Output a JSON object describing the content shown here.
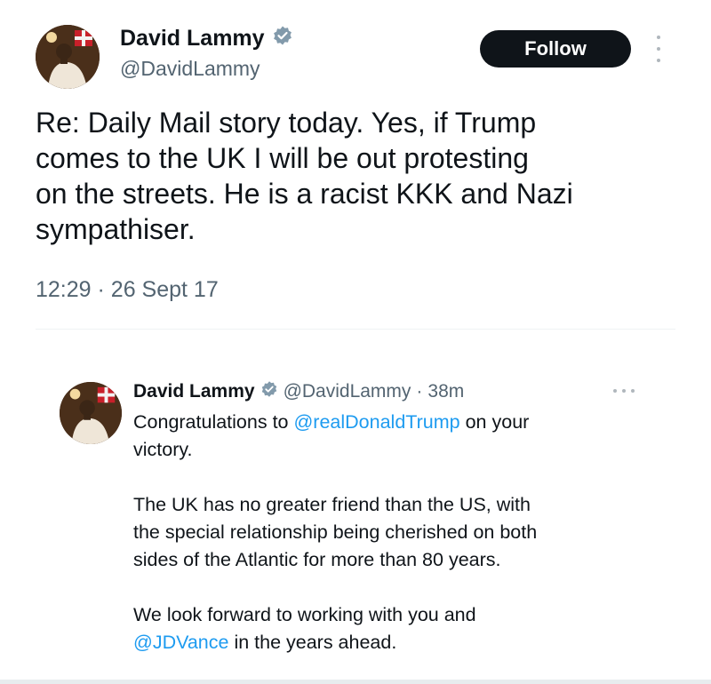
{
  "main_tweet": {
    "author_name": "David Lammy",
    "handle": "@DavidLammy",
    "follow_label": "Follow",
    "text_lines": [
      "Re: Daily Mail story today. Yes, if Trump",
      "comes to the UK I will be out protesting",
      "on the streets. He is a racist KKK and Nazi",
      "sympathiser."
    ],
    "time": "12:29",
    "separator": "·",
    "date": "26 Sept 17"
  },
  "quoted_tweet": {
    "author_name": "David Lammy",
    "handle": "@DavidLammy",
    "separator": "·",
    "age": "38m",
    "p1_before": "Congratulations to ",
    "p1_mention": "@realDonaldTrump",
    "p1_after_line1": " on your",
    "p1_line2": "victory.",
    "p2_lines": [
      "The UK has no greater friend than the US, with",
      "the special relationship being cherished on both",
      "sides of the Atlantic for more than 80 years."
    ],
    "p3_line1": "We look forward to working with you and",
    "p3_mention": "@JDVance",
    "p3_after": " in the years ahead."
  },
  "colors": {
    "verified_badge": "#829aab",
    "mention": "#1d9bf0",
    "follow_bg": "#0f1419"
  },
  "icons": [
    "verified-badge-icon",
    "more-options-icon"
  ]
}
